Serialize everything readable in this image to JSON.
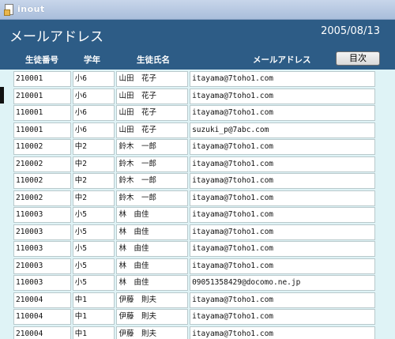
{
  "window": {
    "title": "inout"
  },
  "header": {
    "title": "メールアドレス",
    "date": "2005/08/13",
    "toc_button": "目次",
    "columns": {
      "id": "生徒番号",
      "grade": "学年",
      "name": "生徒氏名",
      "email": "メールアドレス"
    }
  },
  "rows": [
    {
      "id": "210001",
      "grade": "小6",
      "name": "山田　花子",
      "email": "itayama@7toho1.com"
    },
    {
      "id": "210001",
      "grade": "小6",
      "name": "山田　花子",
      "email": "itayama@7toho1.com"
    },
    {
      "id": "110001",
      "grade": "小6",
      "name": "山田　花子",
      "email": "itayama@7toho1.com"
    },
    {
      "id": "110001",
      "grade": "小6",
      "name": "山田　花子",
      "email": "suzuki_p@7abc.com"
    },
    {
      "id": "110002",
      "grade": "中2",
      "name": "鈴木　一郎",
      "email": "itayama@7toho1.com"
    },
    {
      "id": "210002",
      "grade": "中2",
      "name": "鈴木　一郎",
      "email": "itayama@7toho1.com"
    },
    {
      "id": "110002",
      "grade": "中2",
      "name": "鈴木　一郎",
      "email": "itayama@7toho1.com"
    },
    {
      "id": "210002",
      "grade": "中2",
      "name": "鈴木　一郎",
      "email": "itayama@7toho1.com"
    },
    {
      "id": "110003",
      "grade": "小5",
      "name": "林　由佳",
      "email": "itayama@7toho1.com"
    },
    {
      "id": "210003",
      "grade": "小5",
      "name": "林　由佳",
      "email": "itayama@7toho1.com"
    },
    {
      "id": "110003",
      "grade": "小5",
      "name": "林　由佳",
      "email": "itayama@7toho1.com"
    },
    {
      "id": "210003",
      "grade": "小5",
      "name": "林　由佳",
      "email": "itayama@7toho1.com"
    },
    {
      "id": "110003",
      "grade": "小5",
      "name": "林　由佳",
      "email": "09051358429@docomo.ne.jp"
    },
    {
      "id": "210004",
      "grade": "中1",
      "name": "伊藤　則夫",
      "email": "itayama@7toho1.com"
    },
    {
      "id": "110004",
      "grade": "中1",
      "name": "伊藤　則夫",
      "email": "itayama@7toho1.com"
    },
    {
      "id": "210004",
      "grade": "中1",
      "name": "伊藤　則夫",
      "email": "itayama@7toho1.com"
    }
  ]
}
